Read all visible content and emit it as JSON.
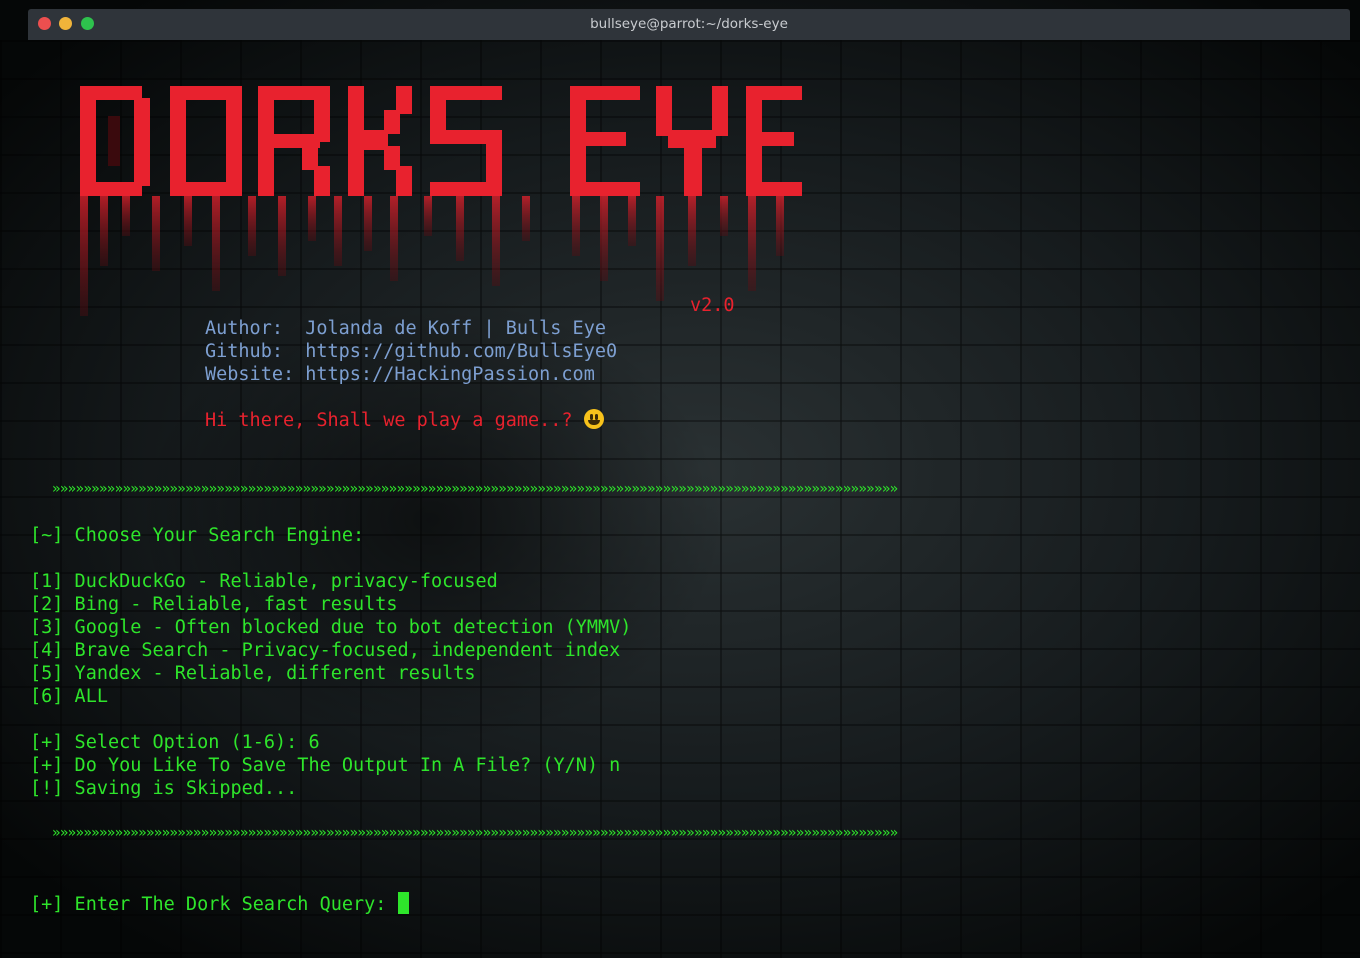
{
  "window": {
    "title": "bullseye@parrot:~/dorks-eye"
  },
  "banner": {
    "logo_text": "DORKS EYE",
    "version": "v2.0"
  },
  "info": {
    "author_line": "Author:  Jolanda de Koff | Bulls Eye",
    "github_line": "Github:  https://github.com/BullsEye0",
    "website_line": "Website: https://HackingPassion.com",
    "greeting": "Hi there, Shall we play a game..? "
  },
  "separator": "»»»»»»»»»»»»»»»»»»»»»»»»»»»»»»»»»»»»»»»»»»»»»»»»»»»»»»»»»»»»»»»»»»»»»»»»»»»»»»»»»»»»»»»»»»»»»»»»»»»»»»»»»»»»",
  "menu": {
    "prompt": "[~] Choose Your Search Engine:",
    "options": [
      "[1] DuckDuckGo - Reliable, privacy-focused",
      "[2] Bing - Reliable, fast results",
      "[3] Google - Often blocked due to bot detection (YMMV)",
      "[4] Brave Search - Privacy-focused, independent index",
      "[5] Yandex - Reliable, different results",
      "[6] ALL"
    ]
  },
  "session": {
    "select_option": "[+] Select Option (1-6): 6",
    "save_question": "[+] Do You Like To Save The Output In A File? (Y/N) n",
    "saving_status": "[!] Saving is Skipped...",
    "query_prompt": "[+] Enter The Dork Search Query: "
  },
  "colors": {
    "prompt_green": "#2ee52b",
    "banner_red": "#e8222e",
    "info_blue": "#7d9fd1"
  }
}
